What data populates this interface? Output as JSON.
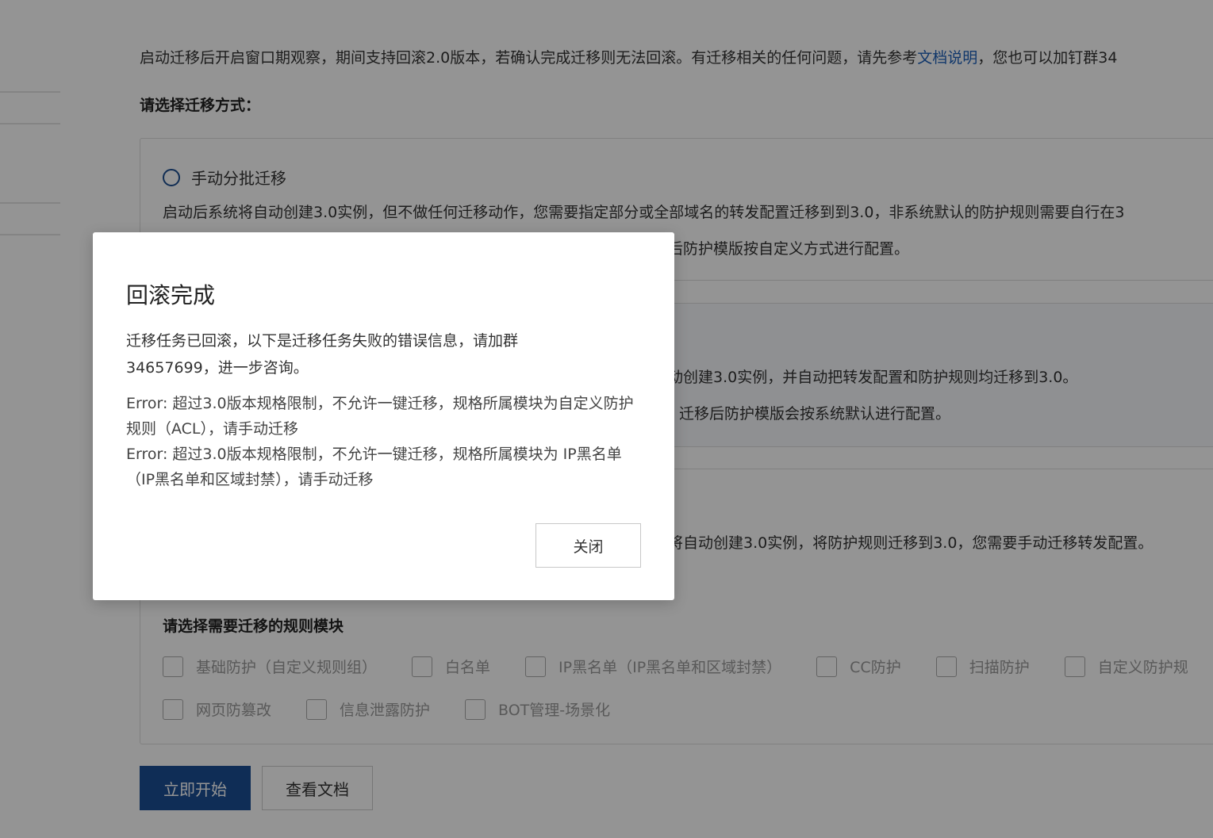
{
  "page": {
    "intro_text": "启动迁移后开启窗口期观察，期间支持回滚2.0版本，若确认完成迁移则无法回滚。有迁移相关的任何问题，请先参考",
    "intro_link": "文档说明",
    "intro_tail": "，您也可以加钉群34",
    "section_title": "请选择迁移方式：",
    "option1": {
      "label": "手动分批迁移",
      "desc1": "启动后系统将自动创建3.0实例，但不做任何迁移动作，您需要指定部分或全部域名的转发配置迁移到到3.0，非系统默认的防护规则需要自行在3",
      "desc2": "后防护模版按自定义方式进行配置。"
    },
    "option2": {
      "desc1": "动创建3.0实例，并自动把转发配置和防护规则均迁移到3.0。",
      "desc2": "迁移后防护模版会按系统默认进行配置。"
    },
    "option3": {
      "desc1": "将自动创建3.0实例，将防护规则迁移到3.0，您需要手动迁移转发配置。"
    },
    "modules_title": "请选择需要迁移的规则模块",
    "modules_row1": [
      "基础防护（自定义规则组）",
      "白名单",
      "IP黑名单（IP黑名单和区域封禁）",
      "CC防护",
      "扫描防护",
      "自定义防护规"
    ],
    "modules_row2": [
      "网页防篡改",
      "信息泄露防护",
      "BOT管理-场景化"
    ],
    "start_button": "立即开始",
    "docs_button": "查看文档"
  },
  "dialog": {
    "title": "回滚完成",
    "message": "迁移任务已回滚，以下是迁移任务失败的错误信息，请加群34657699，进一步咨询。",
    "error1": "Error: 超过3.0版本规格限制，不允许一键迁移，规格所属模块为自定义防护规则（ACL），请手动迁移",
    "error2": "Error: 超过3.0版本规格限制，不允许一键迁移，规格所属模块为 IP黑名单（IP黑名单和区域封禁），请手动迁移",
    "close_button": "关闭"
  },
  "colors": {
    "primary": "#1a4f95",
    "link": "#1d5fb8",
    "overlay": "rgba(0,0,0,0.42)"
  }
}
